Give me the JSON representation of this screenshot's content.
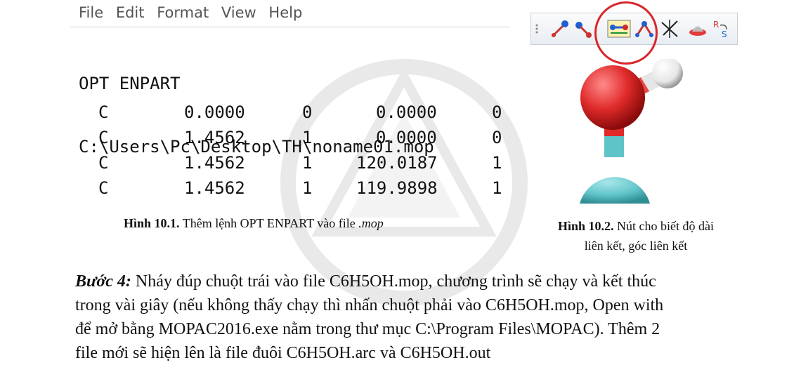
{
  "notepad": {
    "menu": [
      "File",
      "Edit",
      "Format",
      "View",
      "Help"
    ],
    "lines": [
      "OPT ENPART",
      "C:\\Users\\Pc\\Desktop\\TH\\noname01.mop"
    ],
    "rows": [
      [
        "C",
        "0.0000",
        "0",
        "0.0000",
        "0"
      ],
      [
        "C",
        "1.4562",
        "1",
        "0.0000",
        "0"
      ],
      [
        "C",
        "1.4562",
        "1",
        "120.0187",
        "1"
      ],
      [
        "C",
        "1.4562",
        "1",
        "119.9898",
        "1"
      ]
    ]
  },
  "captions": {
    "fig1": {
      "label": "Hình 10.1.",
      "text": " Thêm lệnh OPT ENPART vào file ",
      "ext": ".mop"
    },
    "fig2": {
      "label": "Hình 10.2.",
      "text_line1": " Nút cho biết độ dài",
      "text_line2": "liên kết, góc liên kết"
    }
  },
  "toolbar": {
    "icons": [
      "grip-icon",
      "bond-draw-icon",
      "atom-drag-icon",
      "bond-length-icon",
      "bond-angle-icon",
      "dihedral-icon",
      "hat-icon",
      "rs-chirality-icon"
    ],
    "highlight_color": "#d9262b"
  },
  "molecule": {
    "atoms": [
      "O",
      "H",
      "C"
    ],
    "colors": {
      "oxygen": "#e02a2a",
      "hydrogen": "#f2f2f2",
      "carbon": "#5fc4c8"
    }
  },
  "body": {
    "step_label": "Bước 4:",
    "line1": " Nháy đúp chuột trái vào file C6H5OH.mop, chương trình sẽ chạy và kết thúc",
    "line2": "trong vài giây (nếu không thấy chạy thì nhấn chuột phải vào C6H5OH.mop, Open with",
    "line3": "để mở bằng MOPAC2016.exe nằm trong thư mục C:\\Program Files\\MOPAC). Thêm 2",
    "line4": "file mới sẽ hiện lên là file đuôi C6H5OH.arc và C6H5OH.out"
  }
}
